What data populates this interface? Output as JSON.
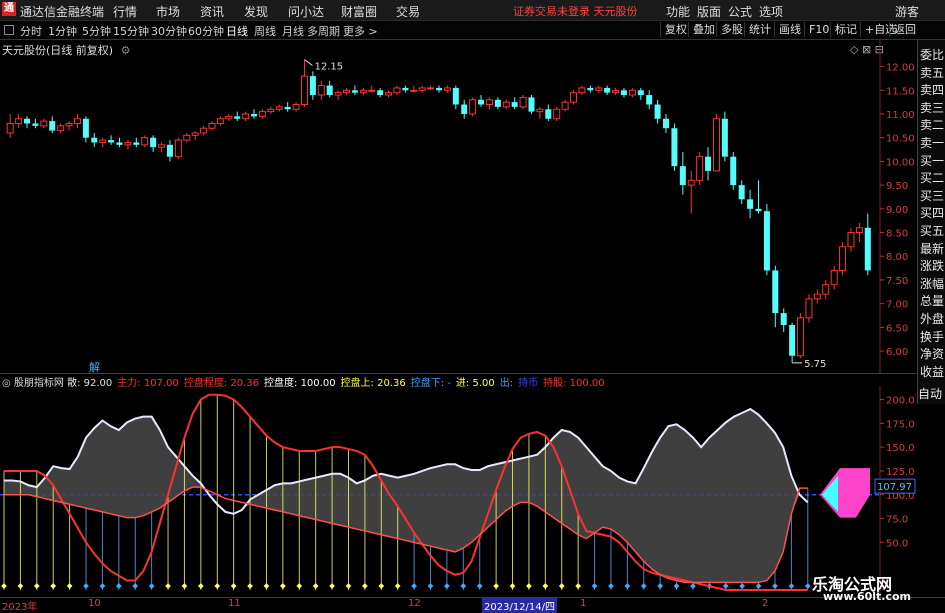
{
  "app": {
    "name": "通达信金融终端",
    "logo": "通"
  },
  "menu": [
    "行情",
    "市场",
    "资讯",
    "发现",
    "问小达",
    "财富圈",
    "交易"
  ],
  "notice": "证券交易未登录  天元股份",
  "top_right": [
    "功能",
    "版面",
    "公式",
    "选项",
    "游客"
  ],
  "periods": [
    "分时",
    "1分钟",
    "5分钟",
    "15分钟",
    "30分钟",
    "60分钟",
    "日线",
    "周线",
    "月线",
    "多周期",
    "更多 >"
  ],
  "active_period": "日线",
  "toolbar": [
    "复权",
    "叠加",
    "多股",
    "统计",
    "画线",
    "F10",
    "标记",
    "+自选",
    "返回"
  ],
  "main_title": "天元股份(日线 前复权)",
  "price_axis": [
    "12.00",
    "11.50",
    "11.00",
    "10.50",
    "10.00",
    "9.50",
    "9.00",
    "8.50",
    "8.00",
    "7.50",
    "7.00",
    "6.50",
    "6.00"
  ],
  "annotations": {
    "high": "12.15",
    "low": "5.75"
  },
  "side_panel": [
    "委比",
    "卖五",
    "卖四",
    "卖三",
    "卖二",
    "卖一",
    "买一",
    "买二",
    "买三",
    "买四",
    "买五",
    "最新",
    "涨跌",
    "涨幅",
    "总量",
    "外盘",
    "换手",
    "净资",
    "收益"
  ],
  "auto_label": "自动",
  "solve_label": "解",
  "indicator": {
    "name": "股朋指标网",
    "items": [
      {
        "label": "散:",
        "value": "92.00",
        "color": "#e0e0e0"
      },
      {
        "label": "主力:",
        "value": "107.00",
        "color": "#ff3030"
      },
      {
        "label": "控盘程度:",
        "value": "20.36",
        "color": "#ff3030"
      },
      {
        "label": "控盘度:",
        "value": "100.00",
        "color": "#ffffff"
      },
      {
        "label": "控盘上:",
        "value": "20.36",
        "color": "#ffff40"
      },
      {
        "label": "控盘下:",
        "value": "-",
        "color": "#40a0ff"
      },
      {
        "label": "进:",
        "value": "5.00",
        "color": "#ffff40"
      },
      {
        "label": "出:",
        "value": "",
        "color": "#40a0ff"
      },
      {
        "label": "持币",
        "value": "",
        "color": "#4040ff"
      },
      {
        "label": "持股:",
        "value": "100.00",
        "color": "#ff3030"
      }
    ]
  },
  "ind_axis": [
    "200.0",
    "175.0",
    "150.0",
    "125.0",
    "100.0",
    "75.0",
    "50.0"
  ],
  "ind_current": "107.97",
  "x_labels": [
    "2023年",
    "10",
    "11",
    "12",
    "2023/12/14/四",
    "1",
    "2"
  ],
  "watermark": {
    "title": "乐淘公式网",
    "url": "www.60lt.com"
  },
  "colors": {
    "up": "#ff3232",
    "down": "#54fcfc",
    "grid": "#802020"
  },
  "chart_data": {
    "type": "candlestick",
    "title": "天元股份(日线 前复权)",
    "candles": [
      {
        "o": 10.6,
        "h": 11.0,
        "l": 10.5,
        "c": 10.8
      },
      {
        "o": 10.8,
        "h": 11.0,
        "l": 10.7,
        "c": 10.9
      },
      {
        "o": 10.9,
        "h": 10.95,
        "l": 10.7,
        "c": 10.8
      },
      {
        "o": 10.8,
        "h": 10.9,
        "l": 10.7,
        "c": 10.75
      },
      {
        "o": 10.75,
        "h": 10.9,
        "l": 10.7,
        "c": 10.85
      },
      {
        "o": 10.85,
        "h": 10.95,
        "l": 10.6,
        "c": 10.65
      },
      {
        "o": 10.65,
        "h": 10.8,
        "l": 10.6,
        "c": 10.75
      },
      {
        "o": 10.75,
        "h": 10.85,
        "l": 10.65,
        "c": 10.8
      },
      {
        "o": 10.8,
        "h": 11.0,
        "l": 10.7,
        "c": 10.9
      },
      {
        "o": 10.9,
        "h": 10.95,
        "l": 10.4,
        "c": 10.5
      },
      {
        "o": 10.5,
        "h": 10.6,
        "l": 10.3,
        "c": 10.4
      },
      {
        "o": 10.4,
        "h": 10.5,
        "l": 10.3,
        "c": 10.45
      },
      {
        "o": 10.45,
        "h": 10.55,
        "l": 10.35,
        "c": 10.4
      },
      {
        "o": 10.4,
        "h": 10.5,
        "l": 10.3,
        "c": 10.35
      },
      {
        "o": 10.35,
        "h": 10.45,
        "l": 10.25,
        "c": 10.4
      },
      {
        "o": 10.4,
        "h": 10.5,
        "l": 10.3,
        "c": 10.35
      },
      {
        "o": 10.35,
        "h": 10.55,
        "l": 10.3,
        "c": 10.5
      },
      {
        "o": 10.5,
        "h": 10.55,
        "l": 10.2,
        "c": 10.3
      },
      {
        "o": 10.3,
        "h": 10.4,
        "l": 10.2,
        "c": 10.35
      },
      {
        "o": 10.35,
        "h": 10.45,
        "l": 10.0,
        "c": 10.1
      },
      {
        "o": 10.1,
        "h": 10.5,
        "l": 10.05,
        "c": 10.45
      },
      {
        "o": 10.45,
        "h": 10.6,
        "l": 10.4,
        "c": 10.55
      },
      {
        "o": 10.55,
        "h": 10.65,
        "l": 10.45,
        "c": 10.6
      },
      {
        "o": 10.6,
        "h": 10.75,
        "l": 10.55,
        "c": 10.7
      },
      {
        "o": 10.7,
        "h": 10.85,
        "l": 10.65,
        "c": 10.8
      },
      {
        "o": 10.8,
        "h": 10.95,
        "l": 10.75,
        "c": 10.9
      },
      {
        "o": 10.9,
        "h": 11.0,
        "l": 10.85,
        "c": 10.95
      },
      {
        "o": 10.95,
        "h": 11.05,
        "l": 10.85,
        "c": 10.9
      },
      {
        "o": 10.9,
        "h": 11.05,
        "l": 10.85,
        "c": 11.0
      },
      {
        "o": 11.0,
        "h": 11.1,
        "l": 10.9,
        "c": 10.95
      },
      {
        "o": 10.95,
        "h": 11.1,
        "l": 10.9,
        "c": 11.05
      },
      {
        "o": 11.05,
        "h": 11.15,
        "l": 11.0,
        "c": 11.1
      },
      {
        "o": 11.1,
        "h": 11.2,
        "l": 11.05,
        "c": 11.15
      },
      {
        "o": 11.15,
        "h": 11.25,
        "l": 11.05,
        "c": 11.1
      },
      {
        "o": 11.1,
        "h": 11.25,
        "l": 11.05,
        "c": 11.2
      },
      {
        "o": 11.2,
        "h": 12.15,
        "l": 11.15,
        "c": 11.8
      },
      {
        "o": 11.8,
        "h": 11.9,
        "l": 11.3,
        "c": 11.4
      },
      {
        "o": 11.4,
        "h": 11.7,
        "l": 11.3,
        "c": 11.6
      },
      {
        "o": 11.6,
        "h": 11.7,
        "l": 11.35,
        "c": 11.4
      },
      {
        "o": 11.4,
        "h": 11.5,
        "l": 11.3,
        "c": 11.45
      },
      {
        "o": 11.45,
        "h": 11.55,
        "l": 11.4,
        "c": 11.5
      },
      {
        "o": 11.5,
        "h": 11.6,
        "l": 11.4,
        "c": 11.45
      },
      {
        "o": 11.45,
        "h": 11.55,
        "l": 11.4,
        "c": 11.5
      },
      {
        "o": 11.5,
        "h": 11.6,
        "l": 11.45,
        "c": 11.5
      },
      {
        "o": 11.5,
        "h": 11.55,
        "l": 11.35,
        "c": 11.4
      },
      {
        "o": 11.4,
        "h": 11.5,
        "l": 11.35,
        "c": 11.45
      },
      {
        "o": 11.45,
        "h": 11.6,
        "l": 11.4,
        "c": 11.55
      },
      {
        "o": 11.55,
        "h": 11.6,
        "l": 11.45,
        "c": 11.5
      },
      {
        "o": 11.5,
        "h": 11.6,
        "l": 11.45,
        "c": 11.5
      },
      {
        "o": 11.5,
        "h": 11.6,
        "l": 11.45,
        "c": 11.55
      },
      {
        "o": 11.55,
        "h": 11.6,
        "l": 11.5,
        "c": 11.55
      },
      {
        "o": 11.55,
        "h": 11.6,
        "l": 11.45,
        "c": 11.5
      },
      {
        "o": 11.5,
        "h": 11.6,
        "l": 11.45,
        "c": 11.55
      },
      {
        "o": 11.55,
        "h": 11.6,
        "l": 11.1,
        "c": 11.2
      },
      {
        "o": 11.2,
        "h": 11.3,
        "l": 10.9,
        "c": 11.0
      },
      {
        "o": 11.0,
        "h": 11.35,
        "l": 10.95,
        "c": 11.3
      },
      {
        "o": 11.3,
        "h": 11.4,
        "l": 11.15,
        "c": 11.2
      },
      {
        "o": 11.2,
        "h": 11.35,
        "l": 11.1,
        "c": 11.3
      },
      {
        "o": 11.3,
        "h": 11.35,
        "l": 11.1,
        "c": 11.15
      },
      {
        "o": 11.15,
        "h": 11.3,
        "l": 11.1,
        "c": 11.25
      },
      {
        "o": 11.25,
        "h": 11.35,
        "l": 11.1,
        "c": 11.15
      },
      {
        "o": 11.15,
        "h": 11.4,
        "l": 11.1,
        "c": 11.35
      },
      {
        "o": 11.35,
        "h": 11.4,
        "l": 11.0,
        "c": 11.05
      },
      {
        "o": 11.05,
        "h": 11.15,
        "l": 10.9,
        "c": 11.1
      },
      {
        "o": 11.1,
        "h": 11.2,
        "l": 10.85,
        "c": 10.9
      },
      {
        "o": 10.9,
        "h": 11.15,
        "l": 10.85,
        "c": 11.1
      },
      {
        "o": 11.1,
        "h": 11.3,
        "l": 11.05,
        "c": 11.25
      },
      {
        "o": 11.25,
        "h": 11.5,
        "l": 11.2,
        "c": 11.45
      },
      {
        "o": 11.45,
        "h": 11.6,
        "l": 11.4,
        "c": 11.55
      },
      {
        "o": 11.55,
        "h": 11.6,
        "l": 11.45,
        "c": 11.5
      },
      {
        "o": 11.5,
        "h": 11.6,
        "l": 11.45,
        "c": 11.55
      },
      {
        "o": 11.55,
        "h": 11.6,
        "l": 11.4,
        "c": 11.45
      },
      {
        "o": 11.45,
        "h": 11.55,
        "l": 11.4,
        "c": 11.5
      },
      {
        "o": 11.5,
        "h": 11.55,
        "l": 11.35,
        "c": 11.4
      },
      {
        "o": 11.4,
        "h": 11.55,
        "l": 11.35,
        "c": 11.5
      },
      {
        "o": 11.5,
        "h": 11.55,
        "l": 11.3,
        "c": 11.4
      },
      {
        "o": 11.4,
        "h": 11.5,
        "l": 11.1,
        "c": 11.2
      },
      {
        "o": 11.2,
        "h": 11.3,
        "l": 10.8,
        "c": 10.9
      },
      {
        "o": 10.9,
        "h": 11.0,
        "l": 10.6,
        "c": 10.7
      },
      {
        "o": 10.7,
        "h": 10.8,
        "l": 9.8,
        "c": 9.9
      },
      {
        "o": 9.9,
        "h": 10.2,
        "l": 9.3,
        "c": 9.5
      },
      {
        "o": 9.5,
        "h": 9.8,
        "l": 8.9,
        "c": 9.6
      },
      {
        "o": 9.6,
        "h": 10.2,
        "l": 9.5,
        "c": 10.1
      },
      {
        "o": 10.1,
        "h": 10.3,
        "l": 9.6,
        "c": 9.8
      },
      {
        "o": 9.8,
        "h": 11.0,
        "l": 9.8,
        "c": 10.9
      },
      {
        "o": 10.9,
        "h": 11.05,
        "l": 10.0,
        "c": 10.1
      },
      {
        "o": 10.1,
        "h": 10.2,
        "l": 9.4,
        "c": 9.5
      },
      {
        "o": 9.5,
        "h": 9.6,
        "l": 9.1,
        "c": 9.2
      },
      {
        "o": 9.2,
        "h": 9.4,
        "l": 8.8,
        "c": 9.0
      },
      {
        "o": 9.0,
        "h": 9.6,
        "l": 8.9,
        "c": 8.95
      },
      {
        "o": 8.95,
        "h": 9.1,
        "l": 7.6,
        "c": 7.7
      },
      {
        "o": 7.7,
        "h": 7.8,
        "l": 6.5,
        "c": 6.8
      },
      {
        "o": 6.8,
        "h": 6.9,
        "l": 6.4,
        "c": 6.55
      },
      {
        "o": 6.55,
        "h": 6.6,
        "l": 5.75,
        "c": 5.9
      },
      {
        "o": 5.9,
        "h": 6.8,
        "l": 5.85,
        "c": 6.7
      },
      {
        "o": 6.7,
        "h": 7.2,
        "l": 6.6,
        "c": 7.1
      },
      {
        "o": 7.1,
        "h": 7.3,
        "l": 7.0,
        "c": 7.2
      },
      {
        "o": 7.2,
        "h": 7.5,
        "l": 7.1,
        "c": 7.4
      },
      {
        "o": 7.4,
        "h": 7.8,
        "l": 7.3,
        "c": 7.7
      },
      {
        "o": 7.7,
        "h": 8.3,
        "l": 7.6,
        "c": 8.2
      },
      {
        "o": 8.2,
        "h": 8.6,
        "l": 8.1,
        "c": 8.5
      },
      {
        "o": 8.5,
        "h": 8.7,
        "l": 8.3,
        "c": 8.6
      },
      {
        "o": 8.6,
        "h": 8.9,
        "l": 7.6,
        "c": 7.7
      }
    ],
    "y_range": [
      5.75,
      12.15
    ],
    "indicator_series": {
      "range": [
        0,
        210
      ],
      "white": [
        115,
        115,
        114,
        110,
        108,
        118,
        130,
        128,
        127,
        140,
        160,
        170,
        178,
        172,
        168,
        176,
        180,
        182,
        182,
        168,
        150,
        140,
        130,
        120,
        112,
        100,
        90,
        82,
        80,
        84,
        95,
        100,
        105,
        110,
        112,
        112,
        114,
        116,
        118,
        120,
        122,
        122,
        118,
        112,
        115,
        120,
        122,
        120,
        118,
        120,
        122,
        125,
        128,
        130,
        132,
        132,
        128,
        126,
        126,
        130,
        132,
        134,
        136,
        138,
        140,
        142,
        150,
        160,
        168,
        166,
        160,
        150,
        140,
        130,
        125,
        118,
        114,
        112,
        128,
        145,
        160,
        172,
        174,
        168,
        160,
        150,
        160,
        168,
        176,
        182,
        186,
        190,
        184,
        175,
        165,
        150,
        120,
        100,
        92
      ],
      "red_upper": [
        125,
        125,
        125,
        125,
        125,
        120,
        110,
        95,
        80,
        65,
        50,
        38,
        28,
        20,
        15,
        10,
        10,
        20,
        40,
        70,
        100,
        130,
        160,
        185,
        200,
        205,
        205,
        204,
        200,
        192,
        182,
        172,
        162,
        155,
        150,
        148,
        146,
        146,
        146,
        148,
        150,
        150,
        148,
        146,
        142,
        130,
        115,
        100,
        88,
        74,
        60,
        48,
        36,
        26,
        20,
        16,
        18,
        30,
        55,
        80,
        105,
        128,
        148,
        160,
        164,
        166,
        162,
        150,
        130,
        105,
        80,
        62,
        60,
        58,
        56,
        50,
        40,
        30,
        22,
        18,
        16,
        14,
        12,
        10,
        8,
        6,
        4,
        2,
        0,
        0,
        0,
        0,
        0,
        0,
        0,
        0,
        0,
        0,
        0
      ],
      "red_lower": [
        100,
        100,
        100,
        100,
        98,
        96,
        94,
        92,
        90,
        88,
        86,
        84,
        82,
        80,
        78,
        76,
        76,
        78,
        82,
        86,
        92,
        98,
        104,
        108,
        108,
        104,
        100,
        96,
        94,
        92,
        90,
        88,
        86,
        84,
        82,
        80,
        78,
        76,
        74,
        72,
        70,
        68,
        66,
        64,
        62,
        60,
        58,
        56,
        54,
        52,
        50,
        48,
        46,
        44,
        42,
        40,
        44,
        50,
        58,
        66,
        74,
        82,
        88,
        92,
        92,
        88,
        82,
        76,
        70,
        64,
        58,
        54,
        60,
        66,
        64,
        58,
        50,
        40,
        30,
        22,
        16,
        12,
        10,
        8,
        8,
        8,
        8,
        8,
        8,
        8,
        8,
        8,
        8,
        10,
        20,
        40,
        80,
        107,
        107
      ]
    },
    "xlabels": [
      "2023年",
      "10",
      "11",
      "12",
      "2023/12/14/四",
      "1",
      "2"
    ]
  }
}
